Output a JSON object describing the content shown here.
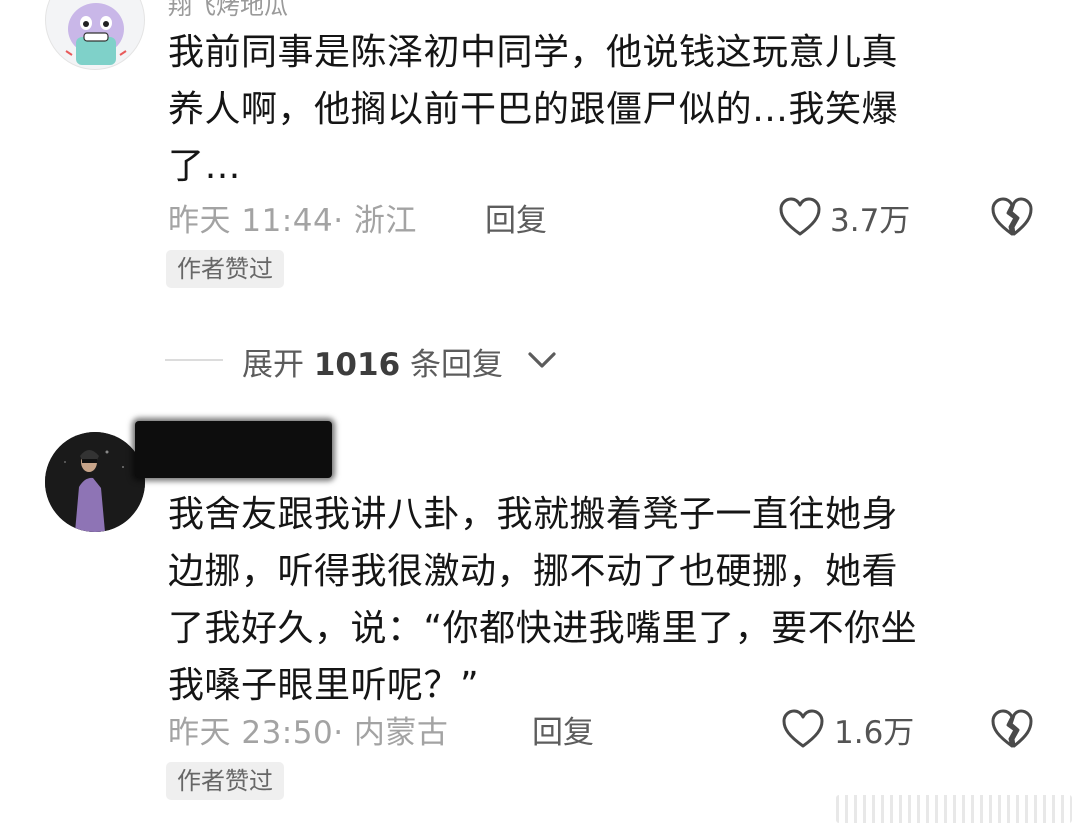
{
  "comments": [
    {
      "username": "翔飞烤地瓜",
      "text": "我前同事是陈泽初中同学，他说钱这玩意儿真\n养人啊，他搁以前干巴的跟僵尸似的…我笑爆\n了…",
      "time": "昨天 11:44· 浙江",
      "reply_label": "回复",
      "likes": "3.7万",
      "badge": "作者赞过",
      "avatar": "cartoon-avatar"
    },
    {
      "username": "",
      "text": "我舍友跟我讲八卦，我就搬着凳子一直往她身\n边挪，听得我很激动，挪不动了也硬挪，她看\n了我好久，说：“你都快进我嘴里了，要不你坐\n我嗓子眼里听呢？”",
      "time": "昨天 23:50· 内蒙古",
      "reply_label": "回复",
      "likes": "1.6万",
      "badge": "作者赞过",
      "avatar": "photo-avatar"
    }
  ],
  "expand_replies": {
    "prefix": "展开",
    "count": "1016",
    "suffix": "条回复"
  },
  "icons": {
    "like": "heart-outline-icon",
    "dislike": "broken-heart-icon",
    "expand": "chevron-down-icon"
  },
  "colors": {
    "text": "#151515",
    "meta": "#a3a3a3",
    "badge_bg": "#efefef"
  }
}
